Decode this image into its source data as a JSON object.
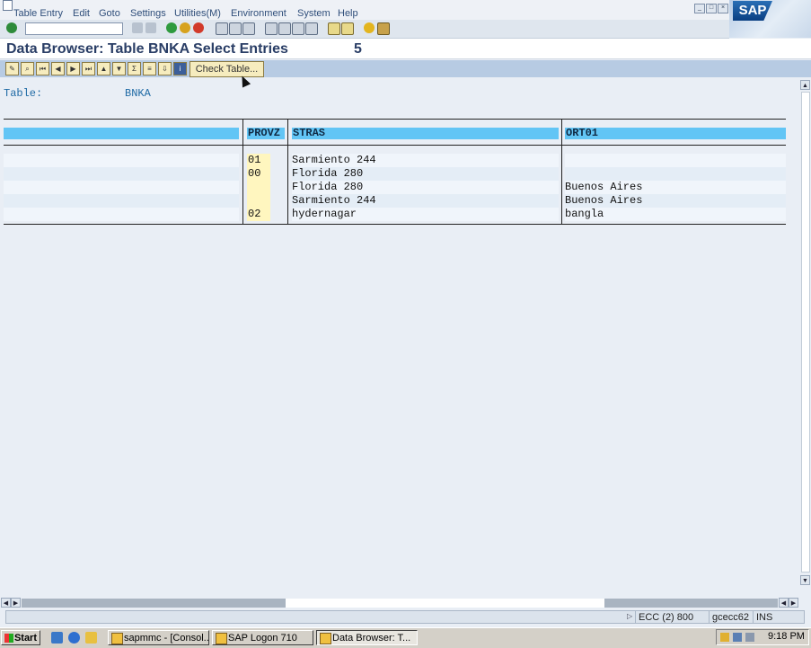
{
  "menubar": {
    "items": [
      "Table Entry",
      "Edit",
      "Goto",
      "Settings",
      "Utilities(M)",
      "Environment",
      "System",
      "Help"
    ],
    "window_controls": [
      "_",
      "□",
      "×"
    ],
    "logo": "SAP"
  },
  "title": {
    "text": "Data Browser: Table BNKA Select Entries",
    "count": "5"
  },
  "app_toolbar": {
    "check_table_label": "Check Table..."
  },
  "selection": {
    "table_label": "Table:",
    "table_value": "BNKA"
  },
  "grid": {
    "columns": [
      "",
      "PROVZ",
      "STRAS",
      "ORT01"
    ],
    "rows": [
      [
        "",
        "01",
        "Sarmiento 244",
        ""
      ],
      [
        "",
        "00",
        "Florida 280",
        ""
      ],
      [
        "",
        "",
        "Florida 280",
        "Buenos Aires"
      ],
      [
        "",
        "",
        "Sarmiento 244",
        "Buenos Aires"
      ],
      [
        "",
        "02",
        "hydernagar",
        "bangla"
      ]
    ]
  },
  "statusbar": {
    "system": "ECC (2) 800",
    "server": "gcecc62",
    "mode": "INS"
  },
  "taskbar": {
    "start_label": "Start",
    "tasks": [
      "sapmmc - [Consol...",
      "SAP Logon 710",
      "Data Browser: T..."
    ],
    "clock": "9:18 PM"
  },
  "colors": {
    "header_bg": "#62c5f5",
    "title_text": "#2a3e66",
    "label_blue": "#1f6aa5",
    "key_cell_bg": "#fff6bf"
  }
}
